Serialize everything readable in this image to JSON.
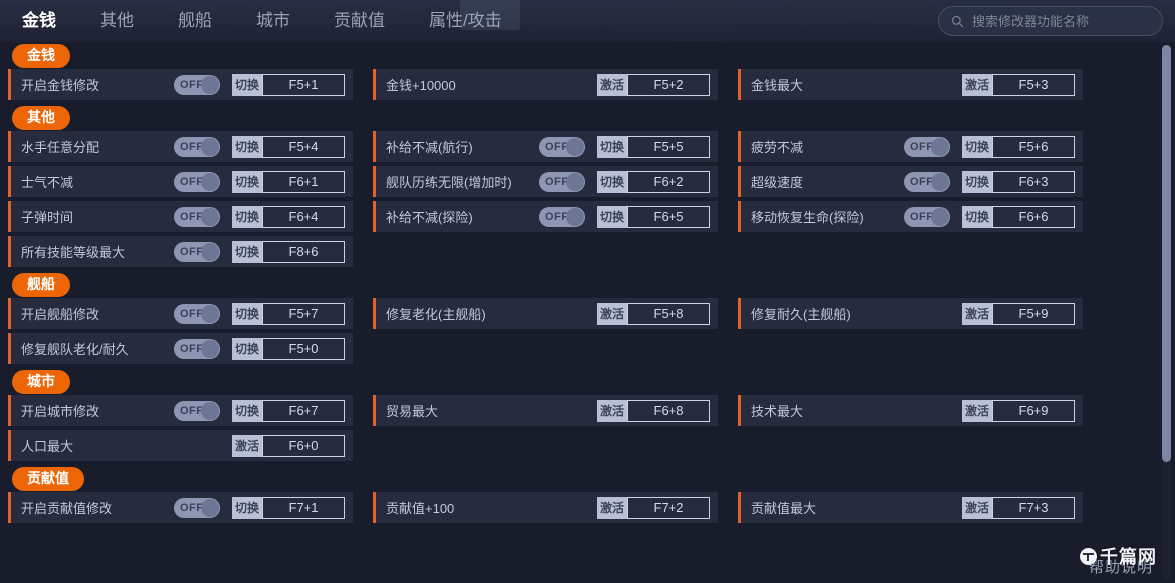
{
  "header": {
    "tabs": [
      {
        "label": "金钱",
        "active": true
      },
      {
        "label": "其他",
        "active": false
      },
      {
        "label": "舰船",
        "active": false
      },
      {
        "label": "城市",
        "active": false
      },
      {
        "label": "贡献值",
        "active": false
      },
      {
        "label": "属性/攻击",
        "active": false
      }
    ],
    "search": {
      "placeholder": "搜索修改器功能名称",
      "value": "",
      "icon": "search-icon"
    }
  },
  "colors": {
    "accent_orange": "#e2622c",
    "badge_orange": "#ec6608",
    "background": "#191c2b",
    "card": "#262b3d",
    "toggle_track": "#8e96b4"
  },
  "toggle_off_label": "OFF",
  "mode_labels": {
    "switch": "切换",
    "activate": "激活"
  },
  "sections": [
    {
      "title": "金钱",
      "rows": [
        [
          {
            "label": "开启金钱修改",
            "toggle": "OFF",
            "mode": "切换",
            "hotkey": "F5+1"
          },
          {
            "label": "金钱+10000",
            "toggle": null,
            "mode": "激活",
            "hotkey": "F5+2"
          },
          {
            "label": "金钱最大",
            "toggle": null,
            "mode": "激活",
            "hotkey": "F5+3"
          }
        ]
      ]
    },
    {
      "title": "其他",
      "rows": [
        [
          {
            "label": "水手任意分配",
            "toggle": "OFF",
            "mode": "切换",
            "hotkey": "F5+4"
          },
          {
            "label": "补给不减(航行)",
            "toggle": "OFF",
            "mode": "切换",
            "hotkey": "F5+5"
          },
          {
            "label": "疲劳不减",
            "toggle": "OFF",
            "mode": "切换",
            "hotkey": "F5+6"
          }
        ],
        [
          {
            "label": "士气不减",
            "toggle": "OFF",
            "mode": "切换",
            "hotkey": "F6+1"
          },
          {
            "label": "舰队历练无限(增加时)",
            "toggle": "OFF",
            "mode": "切换",
            "hotkey": "F6+2"
          },
          {
            "label": "超级速度",
            "toggle": "OFF",
            "mode": "切换",
            "hotkey": "F6+3"
          }
        ],
        [
          {
            "label": "子弹时间",
            "toggle": "OFF",
            "mode": "切换",
            "hotkey": "F6+4"
          },
          {
            "label": "补给不减(探险)",
            "toggle": "OFF",
            "mode": "切换",
            "hotkey": "F6+5"
          },
          {
            "label": "移动恢复生命(探险)",
            "toggle": "OFF",
            "mode": "切换",
            "hotkey": "F6+6"
          }
        ],
        [
          {
            "label": "所有技能等级最大",
            "toggle": "OFF",
            "mode": "切换",
            "hotkey": "F8+6"
          },
          null,
          null
        ]
      ]
    },
    {
      "title": "舰船",
      "rows": [
        [
          {
            "label": "开启舰船修改",
            "toggle": "OFF",
            "mode": "切换",
            "hotkey": "F5+7"
          },
          {
            "label": "修复老化(主舰船)",
            "toggle": null,
            "mode": "激活",
            "hotkey": "F5+8"
          },
          {
            "label": "修复耐久(主舰船)",
            "toggle": null,
            "mode": "激活",
            "hotkey": "F5+9"
          }
        ],
        [
          {
            "label": "修复舰队老化/耐久",
            "toggle": "OFF",
            "mode": "切换",
            "hotkey": "F5+0"
          },
          null,
          null
        ]
      ]
    },
    {
      "title": "城市",
      "rows": [
        [
          {
            "label": "开启城市修改",
            "toggle": "OFF",
            "mode": "切换",
            "hotkey": "F6+7"
          },
          {
            "label": "贸易最大",
            "toggle": null,
            "mode": "激活",
            "hotkey": "F6+8"
          },
          {
            "label": "技术最大",
            "toggle": null,
            "mode": "激活",
            "hotkey": "F6+9"
          }
        ],
        [
          {
            "label": "人口最大",
            "toggle": null,
            "mode": "激活",
            "hotkey": "F6+0"
          },
          null,
          null
        ]
      ]
    },
    {
      "title": "贡献值",
      "rows": [
        [
          {
            "label": "开启贡献值修改",
            "toggle": "OFF",
            "mode": "切换",
            "hotkey": "F7+1"
          },
          {
            "label": "贡献值+100",
            "toggle": null,
            "mode": "激活",
            "hotkey": "F7+2"
          },
          {
            "label": "贡献值最大",
            "toggle": null,
            "mode": "激活",
            "hotkey": "F7+3"
          }
        ]
      ]
    }
  ],
  "footer": {
    "help_label": "帮助说明",
    "watermark_text": "千篇网"
  }
}
